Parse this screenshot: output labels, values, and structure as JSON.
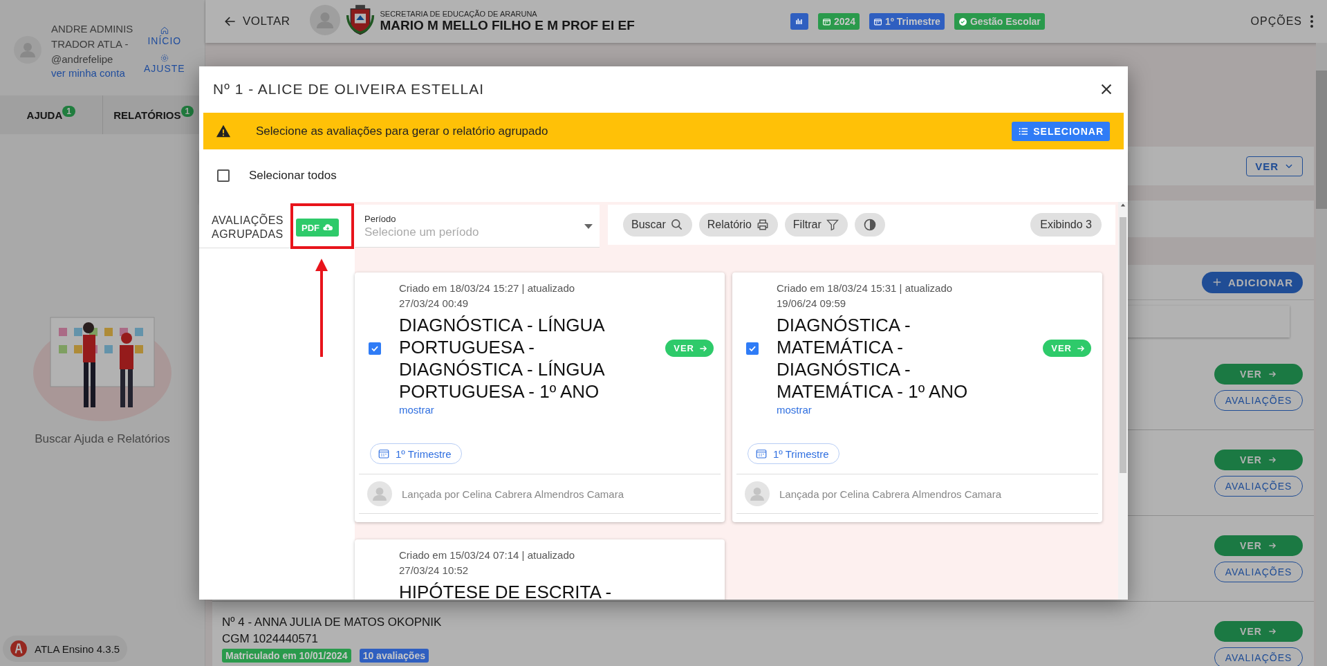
{
  "sidebar": {
    "user": {
      "name": "ANDRE ADMINISTRADOR ATLA -",
      "handle": "@andrefelipe",
      "account_link": "ver minha conta"
    },
    "shortcuts": [
      {
        "label": "INÍCIO",
        "kind": "home"
      },
      {
        "label": "AJUSTE",
        "kind": "settings"
      }
    ],
    "tabs": [
      {
        "label": "AJUDA",
        "badge": "1"
      },
      {
        "label": "RELATÓRIOS",
        "badge": "1"
      }
    ],
    "help_caption": "Buscar Ajuda e Relatórios",
    "version": "ATLA Ensino 4.3.5"
  },
  "topbar": {
    "back": "VOLTAR",
    "org": "SECRETARIA DE EDUCAÇÃO DE ARARUNA",
    "school": "MARIO M MELLO FILHO E M PROF EI EF",
    "chips": [
      {
        "kind": "chart",
        "color": "#2f5fc0"
      },
      {
        "kind": "calendar",
        "label": "2024",
        "color": "#2a9a4c"
      },
      {
        "kind": "calendar",
        "label": "1º Trimestre",
        "color": "#2f5fc0"
      },
      {
        "kind": "check",
        "label": "Gestão Escolar",
        "color": "#2a9a4c"
      }
    ],
    "options": "OPÇÕES"
  },
  "background": {
    "view_button": "VER",
    "add_button": "ADICIONAR",
    "rows": [
      {
        "view": "VER",
        "evaluations": "AVALIAÇÕES"
      },
      {
        "view": "VER",
        "evaluations": "AVALIAÇÕES"
      },
      {
        "view": "VER",
        "evaluations": "AVALIAÇÕES"
      },
      {
        "view": "VER",
        "evaluations": "AVALIAÇÕES",
        "title": "Nº 4 - ANNA JULIA DE MATOS OKOPNIK",
        "cgm": "CGM 1024440571",
        "badges": [
          {
            "label": "Matriculado em 10/01/2024",
            "color": "#2a9a4c"
          },
          {
            "label": "10 avaliações",
            "color": "#2f5fc0"
          }
        ]
      }
    ]
  },
  "modal": {
    "title": "Nº 1 - ALICE DE OLIVEIRA ESTELLAI",
    "banner": {
      "message": "Selecione as avaliações para gerar o relatório agrupado",
      "button": "SELECIONAR"
    },
    "select_all": {
      "label": "Selecionar todos",
      "checked": false
    },
    "group": {
      "label": "AVALIAÇÕES AGRUPADAS",
      "pdf_button": "PDF"
    },
    "period": {
      "label": "Período",
      "placeholder": "Selecione um período"
    },
    "toolbar": [
      {
        "kind": "search",
        "label": "Buscar"
      },
      {
        "kind": "print",
        "label": "Relatório"
      },
      {
        "kind": "filter",
        "label": "Filtrar"
      },
      {
        "kind": "contrast"
      }
    ],
    "count": "Exibindo 3",
    "cards": [
      {
        "created": "Criado em 18/03/24 15:27 | atualizado 27/03/24 00:49",
        "title": "DIAGNÓSTICA - LÍNGUA PORTUGUESA - DIAGNÓSTICA - LÍNGUA PORTUGUESA - 1º ANO",
        "more": "mostrar",
        "view": "VER",
        "period": "1º Trimestre",
        "author": "Lançada por Celina Cabrera Almendros Camara",
        "checked": true
      },
      {
        "created": "Criado em 18/03/24 15:31 | atualizado 19/06/24 09:59",
        "title": "DIAGNÓSTICA - MATEMÁTICA - DIAGNÓSTICA - MATEMÁTICA - 1º ANO",
        "more": "mostrar",
        "view": "VER",
        "period": "1º Trimestre",
        "author": "Lançada por Celina Cabrera Almendros Camara",
        "checked": true
      },
      {
        "created": "Criado em 15/03/24 07:14 | atualizado 27/03/24 10:52",
        "title": "HIPÓTESE DE ESCRITA -"
      }
    ]
  }
}
